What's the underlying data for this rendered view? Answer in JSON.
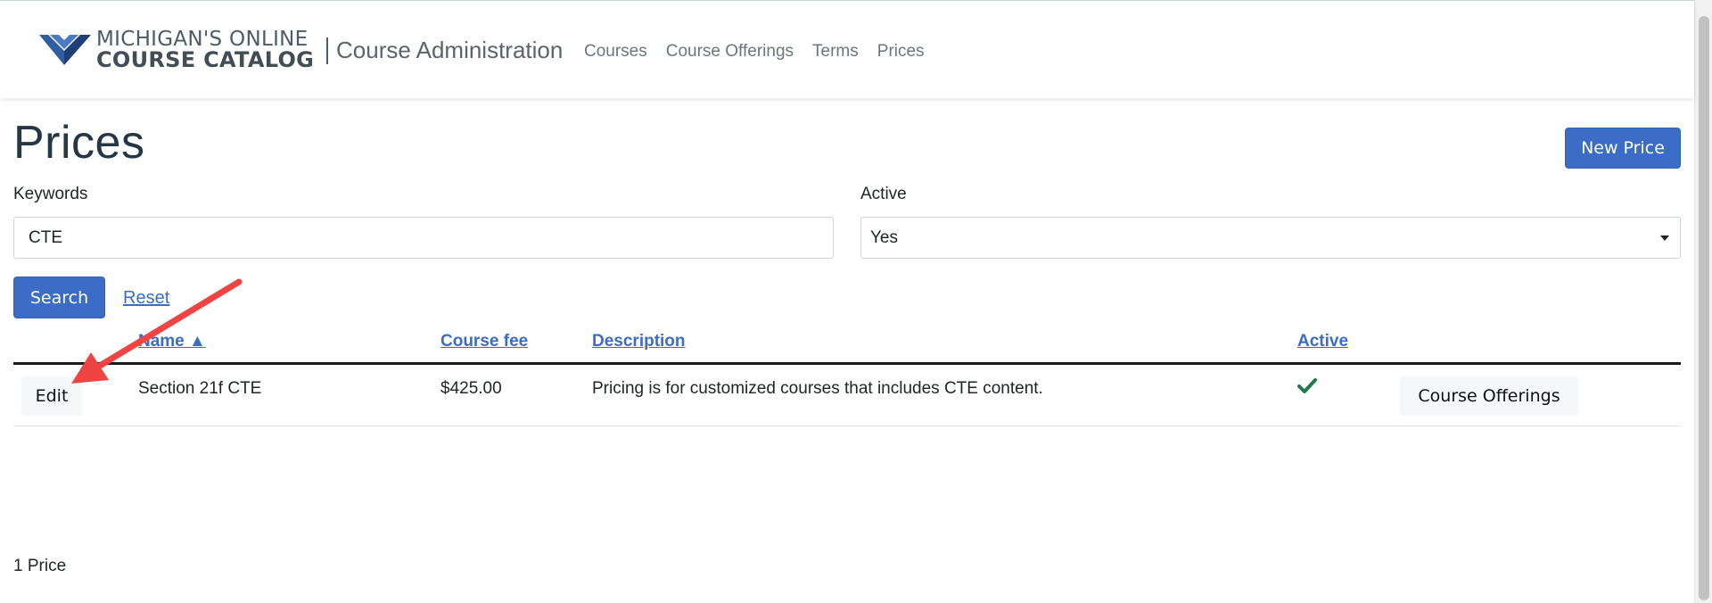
{
  "navbar": {
    "logo_line1": "MICHIGAN'S ONLINE",
    "logo_line2": "COURSE CATALOG",
    "app_title": "Course Administration",
    "links": [
      "Courses",
      "Course Offerings",
      "Terms",
      "Prices"
    ]
  },
  "page": {
    "title": "Prices",
    "new_button": "New Price"
  },
  "filters": {
    "keywords_label": "Keywords",
    "keywords_value": "CTE",
    "active_label": "Active",
    "active_value": "Yes",
    "search_button": "Search",
    "reset_link": "Reset"
  },
  "table": {
    "headers": {
      "name": "Name ▲",
      "fee": "Course fee",
      "description": "Description",
      "active": "Active"
    },
    "rows": [
      {
        "edit_label": "Edit",
        "name": "Section 21f CTE",
        "fee": "$425.00",
        "description": "Pricing is for customized courses that includes CTE content.",
        "active_icon": "checkmark-icon",
        "offerings_label": "Course Offerings"
      }
    ]
  },
  "footer": {
    "count": "1 Price"
  },
  "colors": {
    "primary": "#3b6cc6",
    "title": "#243746",
    "check": "#1f7a4d",
    "annotation": "#ef4444"
  }
}
